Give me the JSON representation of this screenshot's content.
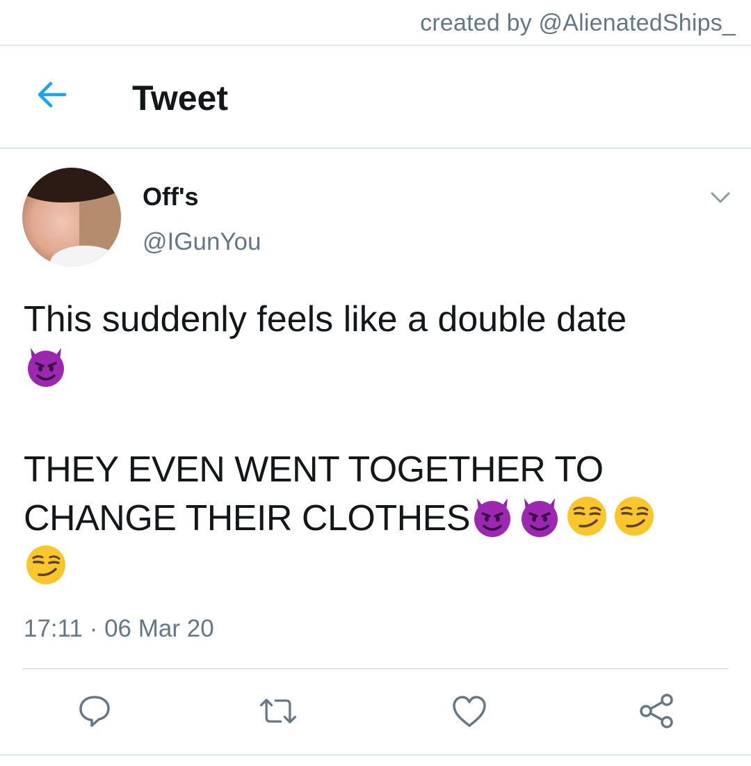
{
  "credit": "created by @AlienatedShips_",
  "header": {
    "title": "Tweet",
    "back_icon": "arrow-left-icon"
  },
  "tweet": {
    "display_name": "Off's",
    "handle": "@IGunYou",
    "text_line1": "This suddenly feels like a double date",
    "text_line2": "THEY EVEN WENT TOGETHER TO",
    "text_line3": "CHANGE THEIR CLOTHES",
    "emojis": [
      "smiling-devil-emoji",
      "smirk-emoji"
    ],
    "timestamp": "17:11 · 06 Mar 20",
    "menu_icon": "chevron-down-icon"
  },
  "actions": {
    "icons": [
      "reply-icon",
      "retweet-icon",
      "like-icon",
      "share-icon"
    ]
  },
  "colors": {
    "accent": "#1da1f2",
    "text": "#14171a",
    "secondary": "#657786",
    "divider": "#e1e8ed",
    "devil_purple": "#9c27b0",
    "smirk_yellow": "#f9c72c"
  }
}
